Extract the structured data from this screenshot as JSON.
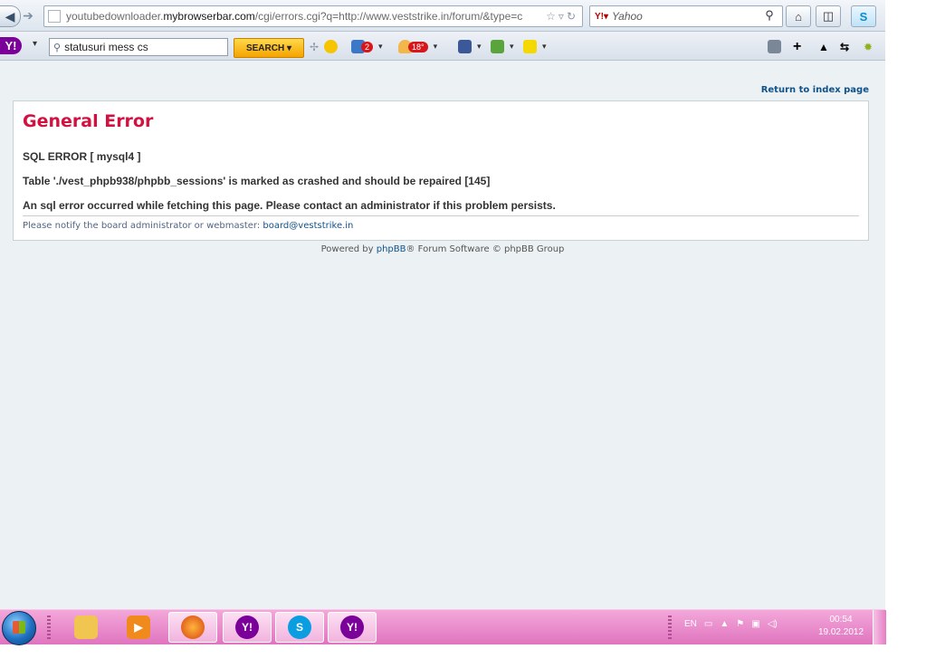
{
  "browser": {
    "url_prefix": "youtubedownloader.",
    "url_domain": "mybrowserbar.com",
    "url_path": "/cgi/errors.cgi?q=http://www.veststrike.in/forum/&type=c",
    "search_engine_placeholder": "Yahoo"
  },
  "yahoo_toolbar": {
    "search_value": "statusuri mess cs",
    "search_button": "SEARCH",
    "mail_count": "2",
    "weather": "18°"
  },
  "page": {
    "return_link": "Return to index page",
    "title": "General Error",
    "sql_error": "SQL ERROR [ mysql4 ]",
    "error_detail": "Table './vest_phpb938/phpbb_sessions' is marked as crashed and should be repaired [145]",
    "error_message": "An sql error occurred while fetching this page. Please contact an administrator if this problem persists.",
    "notify_text": "Please notify the board administrator or webmaster: ",
    "notify_email": "board@veststrike.in",
    "footer_prefix": "Powered by ",
    "footer_link": "phpBB",
    "footer_suffix": "® Forum Software © phpBB Group"
  },
  "taskbar": {
    "language": "EN",
    "time": "00:54",
    "date": "19.02.2012"
  },
  "colors": {
    "error_title": "#d31141",
    "link": "#105289",
    "taskbar": "#e074bf",
    "page_bg": "#ecf1f3"
  }
}
